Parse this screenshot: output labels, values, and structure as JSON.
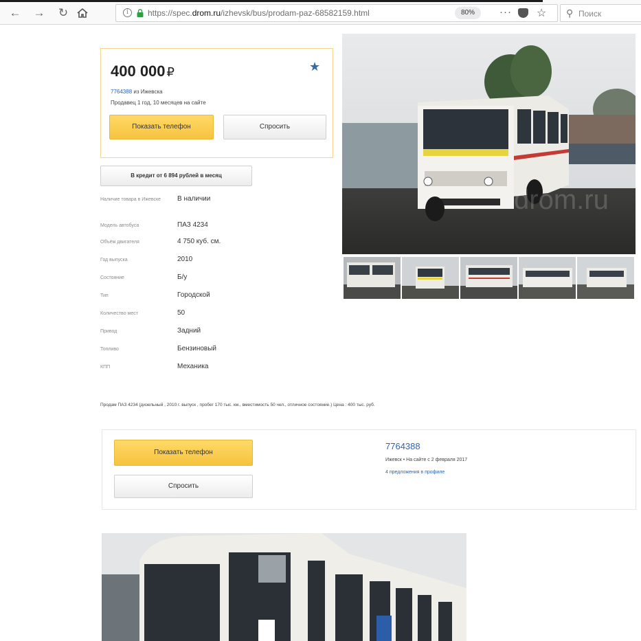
{
  "browser": {
    "url_prefix": "https://spec.",
    "url_domain": "drom.ru",
    "url_path": "/izhevsk/bus/prodam-paz-68582159.html",
    "zoom": "80%",
    "more": "···",
    "search_placeholder": "Поиск"
  },
  "listing": {
    "price": "400 000",
    "currency": "₽",
    "seller_id": "7764388",
    "seller_city": " из Ижевска",
    "seller_since": "Продавец 1 год, 10 месяцев на сайте",
    "show_phone_label": "Показать телефон",
    "ask_label": "Спросить",
    "credit_label": "В кредит от 6 894 рублей в месяц"
  },
  "specs": [
    {
      "key": "Наличие товара в Ижевске",
      "value": "В наличии"
    },
    {
      "key": "Модель автобуса",
      "value": "ПАЗ 4234"
    },
    {
      "key": "Объём двигателя",
      "value": "4 750 куб. см."
    },
    {
      "key": "Год выпуска",
      "value": "2010"
    },
    {
      "key": "Состояние",
      "value": "Б/у"
    },
    {
      "key": "Тип",
      "value": "Городской"
    },
    {
      "key": "Количество мест",
      "value": "50"
    },
    {
      "key": "Привод",
      "value": "Задний"
    },
    {
      "key": "Топливо",
      "value": "Бензиновый"
    },
    {
      "key": "КПП",
      "value": "Механика"
    }
  ],
  "description": "Продам ПАЗ 4234 (дизельный , 2010 г. выпуск , пробег 170 тыс. км., вместимость 50 чел., отличное состояние.) Цена : 400 тыс. руб.",
  "contact": {
    "show_phone_label": "Показать телефон",
    "ask_label": "Спросить",
    "seller_id": "7764388",
    "seller_meta": "Ижевск  •  На сайте с 2 февраля 2017",
    "offers_link": "4 предложения",
    "offers_suffix": " в профиле"
  },
  "icons": {
    "back": "back-arrow-icon",
    "forward": "forward-arrow-icon",
    "reload": "reload-icon",
    "home": "home-icon",
    "info": "info-icon",
    "lock": "lock-icon",
    "pocket": "pocket-icon",
    "bookmark": "star-icon",
    "search": "search-icon",
    "favorite": "favorite-star-icon"
  },
  "colors": {
    "accent_yellow": "#f6c340",
    "link_blue": "#2a64b8",
    "card_border": "#f3d58d"
  }
}
